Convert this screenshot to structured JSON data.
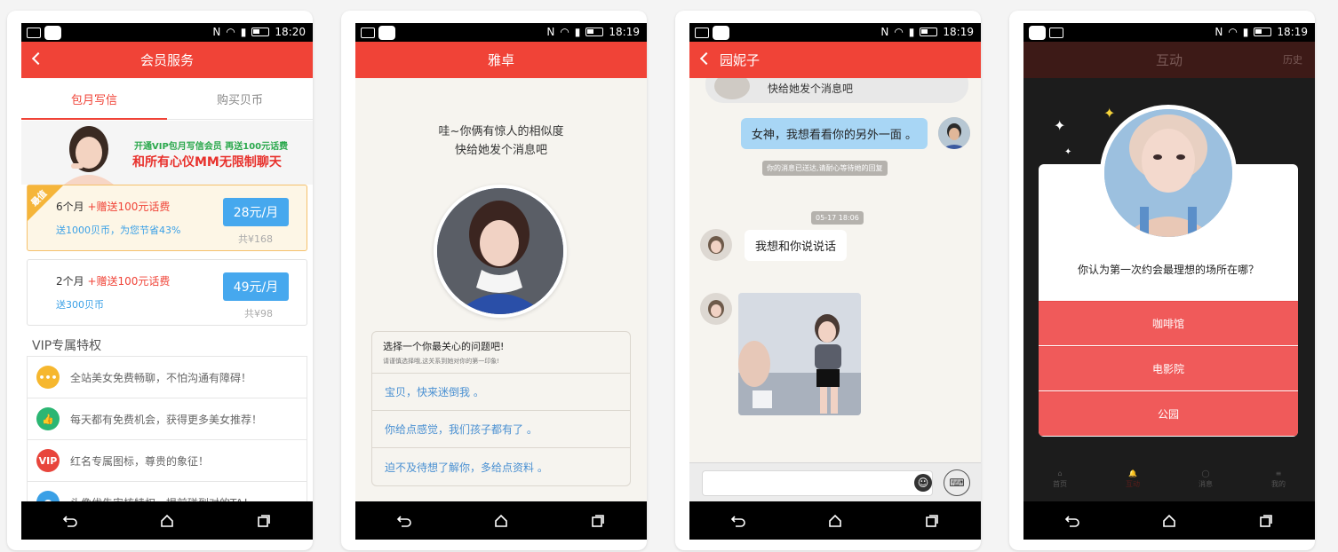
{
  "screens": {
    "membership": {
      "status_time": "18:20",
      "header_title": "会员服务",
      "tabs": [
        "包月写信",
        "购买贝币"
      ],
      "banner": {
        "line1": "开通VIP包月写信会员 再送100元话费",
        "line2": "和所有心仪MM无限制聊天"
      },
      "offers": [
        {
          "badge": "最值",
          "duration": "6个月",
          "bonus": "+赠送100元话费",
          "sub": "送1000贝币，为您节省43%",
          "price": "28元/月",
          "total": "共¥168"
        },
        {
          "badge": "",
          "duration": "2个月",
          "bonus": "+赠送100元话费",
          "sub": "送300贝币",
          "price": "49元/月",
          "total": "共¥98"
        }
      ],
      "vip_title": "VIP专属特权",
      "vip_items": [
        {
          "icon": "chat-icon",
          "color": "#f6b72e",
          "text": "全站美女免费畅聊，不怕沟通有障碍！"
        },
        {
          "icon": "thumbs-up-icon",
          "color": "#2bb673",
          "text": "每天都有免费机会，获得更多美女推荐！"
        },
        {
          "icon": "vip-crown-icon",
          "color": "#e8453c",
          "text": "红名专属图标，尊贵的象征！"
        },
        {
          "icon": "person-icon",
          "color": "#3aa0e6",
          "text": "头像优先审核特权，提前碰到对的TA！"
        }
      ]
    },
    "match": {
      "status_time": "18:19",
      "header_title": "雅卓",
      "message_line1": "哇~你俩有惊人的相似度",
      "message_line2": "快给她发个消息吧",
      "question_title": "选择一个你最关心的问题吧!",
      "question_sub": "请谨慎选择哦,这关系到她对你的第一印象!",
      "options": [
        "宝贝，快来迷倒我 。",
        "你给点感觉，我们孩子都有了 。",
        "迫不及待想了解你，多给点资料 。"
      ]
    },
    "chat": {
      "status_time": "18:19",
      "header_title": "园妮子",
      "top_partial": "快给她发个消息吧",
      "msg_out": "女神，我想看看你的另外一面 。",
      "system_msg": "你的消息已送达,请耐心等待她的回复",
      "timestamp": "05-17 18:06",
      "msg_in": "我想和你说说话"
    },
    "quiz": {
      "status_time": "18:19",
      "header_title": "互动",
      "header_right": "历史",
      "question": "你认为第一次约会最理想的场所在哪？",
      "options": [
        "咖啡馆",
        "电影院",
        "公园"
      ],
      "bottom_tabs": [
        "首页",
        "互动",
        "消息",
        "我的"
      ]
    }
  },
  "colors": {
    "accent_red": "#f04337",
    "link_blue": "#4a90d2",
    "price_blue": "#46a8ee"
  }
}
